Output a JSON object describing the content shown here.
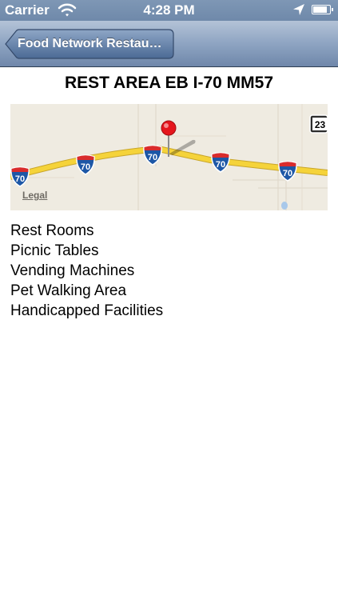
{
  "status_bar": {
    "carrier": "Carrier",
    "time": "4:28 PM",
    "battery_level": 0.9
  },
  "nav": {
    "back_label": "Food Network Restau…"
  },
  "page": {
    "title": "REST AREA EB I-70 MM57"
  },
  "map": {
    "legal_label": "Legal",
    "shields": [
      "70",
      "70",
      "70",
      "70",
      "70"
    ],
    "route_badge": "23",
    "road_color": "#f5d33a",
    "pin_color": "#e5161d"
  },
  "amenities": [
    "Rest Rooms",
    "Picnic Tables",
    "Vending Machines",
    "Pet Walking Area",
    "Handicapped Facilities"
  ]
}
